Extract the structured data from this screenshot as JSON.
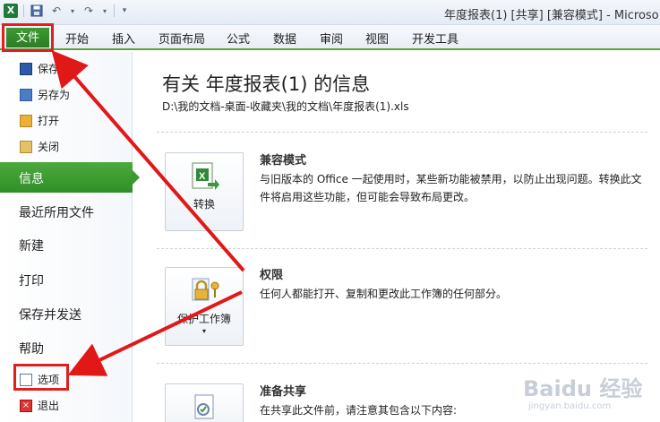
{
  "window": {
    "title": "年度报表(1) [共享] [兼容模式] - Microso"
  },
  "ribbon": {
    "file_tab": "文件",
    "tabs": [
      "开始",
      "插入",
      "页面布局",
      "公式",
      "数据",
      "审阅",
      "视图",
      "开发工具"
    ]
  },
  "nav": {
    "save": "保存",
    "save_as": "另存为",
    "open": "打开",
    "close": "关闭",
    "info": "信息",
    "recent": "最近所用文件",
    "new": "新建",
    "print": "打印",
    "save_send": "保存并发送",
    "help": "帮助",
    "options": "选项",
    "exit": "退出"
  },
  "main": {
    "heading": "有关 年度报表(1) 的信息",
    "path": "D:\\我的文档-桌面-收藏夹\\我的文档\\年度报表(1).xls",
    "sections": [
      {
        "button": "转换",
        "title": "兼容模式",
        "desc": "与旧版本的 Office 一起使用时，某些新功能被禁用，以防止出现问题。转换此文件将启用这些功能，但可能会导致布局更改。"
      },
      {
        "button": "保护工作簿",
        "title": "权限",
        "desc": "任何人都能打开、复制和更改此工作簿的任何部分。"
      },
      {
        "button": "",
        "title": "准备共享",
        "desc": "在共享此文件前，请注意其包含以下内容:"
      }
    ]
  },
  "watermark": {
    "main": "Baidu 经验",
    "sub": "jingyan.baidu.com"
  },
  "colors": {
    "excel_green": "#2d7c25",
    "highlight_red": "#e02020",
    "arrow_red": "#e01818"
  }
}
